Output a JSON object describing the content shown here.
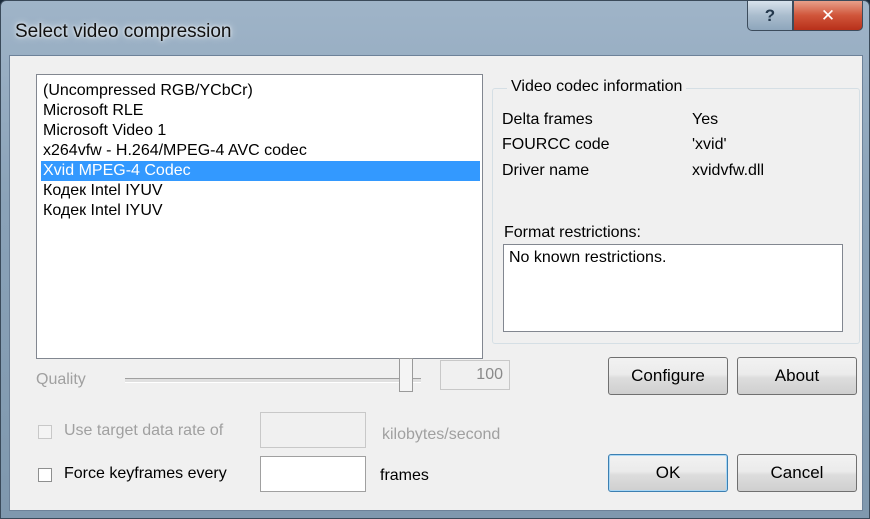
{
  "window": {
    "title": "Select video compression",
    "help_glyph": "?",
    "close_glyph": "✕"
  },
  "codecs": {
    "items": [
      "(Uncompressed RGB/YCbCr)",
      "Microsoft RLE",
      "Microsoft Video 1",
      "x264vfw - H.264/MPEG-4 AVC codec",
      "Xvid MPEG-4 Codec",
      "Кодек Intel IYUV",
      "Кодек Intel IYUV"
    ],
    "selected_index": 4
  },
  "codec_info": {
    "legend": "Video codec information",
    "delta_frames_label": "Delta frames",
    "delta_frames_value": "Yes",
    "fourcc_label": "FOURCC code",
    "fourcc_value": "'xvid'",
    "driver_label": "Driver name",
    "driver_value": "xvidvfw.dll",
    "format_label": "Format restrictions:",
    "format_value": "No known restrictions."
  },
  "quality": {
    "label": "Quality",
    "value": "100",
    "slider_fraction": 1.0
  },
  "buttons": {
    "configure": "Configure",
    "about": "About",
    "ok": "OK",
    "cancel": "Cancel"
  },
  "data_rate": {
    "label": "Use target data rate of",
    "unit": "kilobytes/second",
    "value": "",
    "checked": false,
    "enabled": false
  },
  "keyframes": {
    "label": "Force keyframes every",
    "unit": "frames",
    "value": "",
    "checked": false
  },
  "colors": {
    "selection": "#3399ff",
    "disabled_text": "#a0a0a0"
  }
}
